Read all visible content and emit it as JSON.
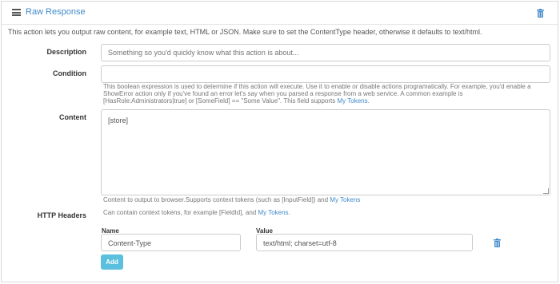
{
  "header": {
    "title": "Raw Response",
    "menu_icon": "hamburger-icon",
    "delete_icon": "trash-icon"
  },
  "description": "This action lets you output raw content, for example text, HTML or JSON. Make sure to set the ContentType header, otherwise it defaults to text/html.",
  "form": {
    "description_label": "Description",
    "description_placeholder": "Something so you'd quickly know what this action is about...",
    "condition_label": "Condition",
    "condition_value": "",
    "condition_help_1": "This boolean expression is used to determine if this action will execute. Use it to enable or disable actions programatically. For example, you'd enable a",
    "condition_help_2": "ShowError action only if you've found an error let's say when you parsed a response from a web service. A common example is",
    "condition_help_3": "[HasRole:Administrators|true] or [SomeField] == \"Some Value\". This field supports",
    "condition_help_link": "My Tokens",
    "condition_help_end": ".",
    "content_label": "Content",
    "content_value": "[store]",
    "content_help": "Content to output to browser.Supports context tokens (such as [InputField]) and",
    "content_help_link": "My Tokens",
    "headers_label": "HTTP Headers",
    "headers_help": "Can contain context tokens, for example [FieldId], and",
    "headers_help_link": "My Tokens",
    "headers_help_end": ".",
    "name_col": "Name",
    "value_col": "Value",
    "header_rows": [
      {
        "name": "Content-Type",
        "value": "text/html; charset=utf-8"
      }
    ],
    "add_label": "Add"
  },
  "colors": {
    "accent": "#428bca",
    "add_button": "#5bc0de"
  }
}
